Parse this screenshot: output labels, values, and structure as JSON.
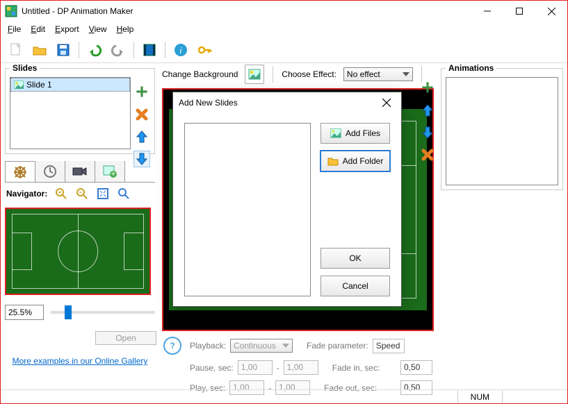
{
  "window": {
    "title": "Untitled - DP Animation Maker",
    "min_icon": "minimize-icon",
    "max_icon": "maximize-icon",
    "close_icon": "close-icon"
  },
  "menu": {
    "file": "File",
    "edit": "Edit",
    "export": "Export",
    "view": "View",
    "help": "Help"
  },
  "slides_panel": {
    "legend": "Slides",
    "items": [
      {
        "label": "Slide 1"
      }
    ]
  },
  "navigator": {
    "label": "Navigator:",
    "zoom_value": "25.5%"
  },
  "open_button": "Open",
  "example_link": "More examples in our Online Gallery",
  "center": {
    "change_bg": "Change Background",
    "choose_effect_lbl": "Choose Effect:",
    "choose_effect_val": "No effect"
  },
  "playback": {
    "label": "Playback:",
    "mode": "Continuous",
    "pause_lbl": "Pause, sec:",
    "play_lbl": "Play, sec:",
    "val_a": "1,00",
    "val_b": "1,00",
    "val_c": "1,00",
    "val_d": "1,00",
    "fade_param_lbl": "Fade parameter:",
    "fade_param_val": "Speed",
    "fade_in_lbl": "Fade in, sec:",
    "fade_in_val": "0,50",
    "fade_out_lbl": "Fade out, sec:",
    "fade_out_val": "0,50",
    "dash": "-"
  },
  "animations_panel": {
    "legend": "Animations"
  },
  "dialog": {
    "title": "Add New Slides",
    "add_files": "Add Files",
    "add_folder": "Add Folder",
    "ok": "OK",
    "cancel": "Cancel"
  },
  "status": {
    "num": "NUM"
  }
}
